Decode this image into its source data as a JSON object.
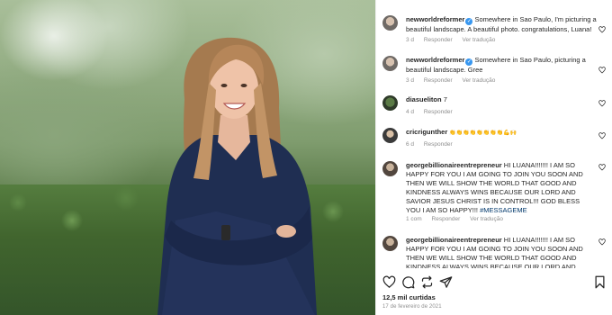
{
  "photo": {
    "alt": ""
  },
  "comments": [
    {
      "user": "newworldreformer",
      "verified": true,
      "text": "Somewhere in Sao Paulo, I'm picturing a beautiful landscape. A beautiful photo. congratulations, Luana!",
      "time": "3 d",
      "reply": "Responder",
      "translate": "Ver tradução"
    },
    {
      "user": "newworldreformer",
      "verified": true,
      "text": "Somewhere in Sao Paulo, picturing a beautiful landscape. Gree",
      "time": "3 d",
      "reply": "Responder",
      "translate": "Ver tradução"
    },
    {
      "user": "diasueliton",
      "verified": false,
      "text": "7",
      "time": "4 d",
      "reply": "Responder"
    },
    {
      "user": "cricrigunther",
      "verified": false,
      "text": "👏👏👏👏👏👏👏👏💪🙌",
      "time": "6 d",
      "reply": "Responder"
    },
    {
      "user": "georgebillionaireentrepreneur",
      "verified": false,
      "text": "HI LUANA!!!!!!! I AM SO HAPPY FOR YOU I AM GOING TO JOIN YOU SOON AND THEN WE WILL SHOW THE WORLD THAT GOOD AND KINDNESS ALWAYS WINS BECAUSE OUR LORD AND SAVIOR JESUS CHRIST IS IN CONTROL!!! GOD BLESS YOU I AM SO HAPPY!!!",
      "hashtag": "#MESSAGEME",
      "likes": "1 com",
      "reply": "Responder",
      "translate": "Ver tradução"
    },
    {
      "user": "georgebillionaireentrepreneur",
      "verified": false,
      "text": "HI LUANA!!!!!!! I AM SO HAPPY FOR YOU I AM GOING TO JOIN YOU SOON AND THEN WE WILL SHOW THE WORLD THAT GOOD AND KINDNESS ALWAYS WINS BECAUSE OUR LORD AND SAVIOR JESUS"
    }
  ],
  "actions": {
    "like_icon": "heart-icon",
    "comment_icon": "comment-icon",
    "share_icon": "share-icon",
    "save_icon": "bookmark-icon",
    "repost_icon": "repost-icon"
  },
  "likes": "12,5 mil curtidas",
  "date": "17 de fevereiro de 2021",
  "colors": {
    "link": "#00376b",
    "meta": "#8e8e8e",
    "verified": "#3897f0"
  }
}
